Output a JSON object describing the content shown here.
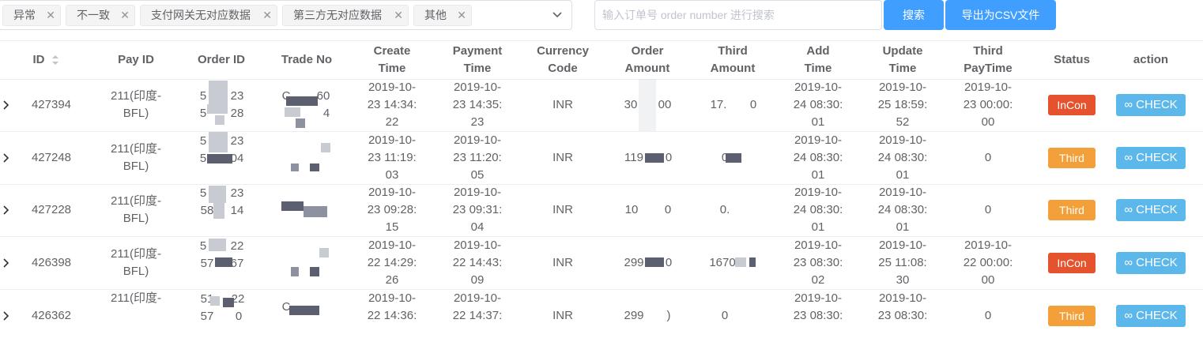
{
  "filter": {
    "tags": [
      {
        "label": "异常"
      },
      {
        "label": "不一致"
      },
      {
        "label": "支付网关无对应数据"
      },
      {
        "label": "第三方无对应数据"
      },
      {
        "label": "其他"
      }
    ],
    "close_glyph": "✕"
  },
  "search": {
    "placeholder": "输入订单号 order number 进行搜索",
    "value": ""
  },
  "buttons": {
    "search": "搜索",
    "export": "导出为CSV文件"
  },
  "table": {
    "headers": [
      {
        "l1": "ID",
        "l2": ""
      },
      {
        "l1": "Pay ID",
        "l2": ""
      },
      {
        "l1": "Order ID",
        "l2": ""
      },
      {
        "l1": "Trade No",
        "l2": ""
      },
      {
        "l1": "Create",
        "l2": "Time"
      },
      {
        "l1": "Payment",
        "l2": "Time"
      },
      {
        "l1": "Currency",
        "l2": "Code"
      },
      {
        "l1": "Order",
        "l2": "Amount"
      },
      {
        "l1": "Third",
        "l2": "Amount"
      },
      {
        "l1": "Add",
        "l2": "Time"
      },
      {
        "l1": "Update",
        "l2": "Time"
      },
      {
        "l1": "Third",
        "l2": "PayTime"
      },
      {
        "l1": "Status",
        "l2": ""
      },
      {
        "l1": "action",
        "l2": ""
      }
    ],
    "rows": [
      {
        "id": "427394",
        "pay_id_1": "211(印度-",
        "pay_id_2": "BFL)",
        "order_id_1": "5",
        "order_id_1b": "23",
        "order_id_2": "5",
        "order_id_2b": "28",
        "trade_1": "C",
        "trade_1b": "60",
        "trade_2": "4",
        "create_1": "2019-10-",
        "create_2": "23 14:34:",
        "create_3": "22",
        "payment_1": "2019-10-",
        "payment_2": "23 14:35:",
        "payment_3": "23",
        "currency": "INR",
        "order_amount_a": "30",
        "order_amount_b": "00",
        "third_amount_a": "17.",
        "third_amount_b": "0",
        "add_1": "2019-10-",
        "add_2": "24 08:30:",
        "add_3": "01",
        "update_1": "2019-10-",
        "update_2": "25 18:59:",
        "update_3": "52",
        "third_pay_1": "2019-10-",
        "third_pay_2": "23 00:00:",
        "third_pay_3": "00",
        "status": "InCon",
        "action": "∞ CHECK"
      },
      {
        "id": "427248",
        "pay_id_1": "211(印度-",
        "pay_id_2": "BFL)",
        "order_id_1": "5",
        "order_id_1b": "23",
        "order_id_2": "5",
        "order_id_2b": "04",
        "create_1": "2019-10-",
        "create_2": "23 11:19:",
        "create_3": "03",
        "payment_1": "2019-10-",
        "payment_2": "23 11:20:",
        "payment_3": "05",
        "currency": "INR",
        "order_amount_a": "119",
        "order_amount_b": "0",
        "third_amount_a": "0",
        "add_1": "2019-10-",
        "add_2": "24 08:30:",
        "add_3": "01",
        "update_1": "2019-10-",
        "update_2": "24 08:30:",
        "update_3": "01",
        "third_pay": "0",
        "status": "Third",
        "action": "∞ CHECK"
      },
      {
        "id": "427228",
        "pay_id_1": "211(印度-",
        "pay_id_2": "BFL)",
        "order_id_1": "5",
        "order_id_1b": "23",
        "order_id_2": "58",
        "order_id_2b": "14",
        "create_1": "2019-10-",
        "create_2": "23 09:28:",
        "create_3": "15",
        "payment_1": "2019-10-",
        "payment_2": "23 09:31:",
        "payment_3": "04",
        "currency": "INR",
        "order_amount_a": "10",
        "order_amount_b": "0",
        "third_amount_a": "0.",
        "add_1": "2019-10-",
        "add_2": "24 08:30:",
        "add_3": "01",
        "update_1": "2019-10-",
        "update_2": "24 08:30:",
        "update_3": "01",
        "third_pay": "0",
        "status": "Third",
        "action": "∞ CHECK"
      },
      {
        "id": "426398",
        "pay_id_1": "211(印度-",
        "pay_id_2": "BFL)",
        "order_id_1": "5",
        "order_id_1b": "22",
        "order_id_2": "57",
        "order_id_2b": "67",
        "create_1": "2019-10-",
        "create_2": "22 14:29:",
        "create_3": "26",
        "payment_1": "2019-10-",
        "payment_2": "22 14:43:",
        "payment_3": "09",
        "currency": "INR",
        "order_amount_a": "299",
        "order_amount_b": "0",
        "third_amount_a": "1670",
        "add_1": "2019-10-",
        "add_2": "23 08:30:",
        "add_3": "02",
        "update_1": "2019-10-",
        "update_2": "25 11:08:",
        "update_3": "30",
        "third_pay_1": "2019-10-",
        "third_pay_2": "22 00:00:",
        "third_pay_3": "00",
        "status": "InCon",
        "action": "∞ CHECK"
      },
      {
        "id": "426362",
        "pay_id_1": "211(印度-",
        "order_id_1": "51",
        "order_id_1b": "22",
        "order_id_2": "57",
        "order_id_2b": "0",
        "trade_1": "C",
        "create_1": "2019-10-",
        "create_2": "22 14:36:",
        "payment_1": "2019-10-",
        "payment_2": "22 14:37:",
        "currency": "INR",
        "order_amount_a": "299",
        "order_amount_b": ")",
        "third_amount_a": "0",
        "add_1": "2019-10-",
        "add_2": "23 08:30:",
        "update_1": "2019-10-",
        "update_2": "23 08:30:",
        "third_pay": "0",
        "status": "Third",
        "action": "∞ CHECK"
      }
    ]
  },
  "colors": {
    "primary": "#409eff",
    "status_incon": "#e5532e",
    "status_third": "#f4a03a",
    "check": "#5cb8ea"
  }
}
